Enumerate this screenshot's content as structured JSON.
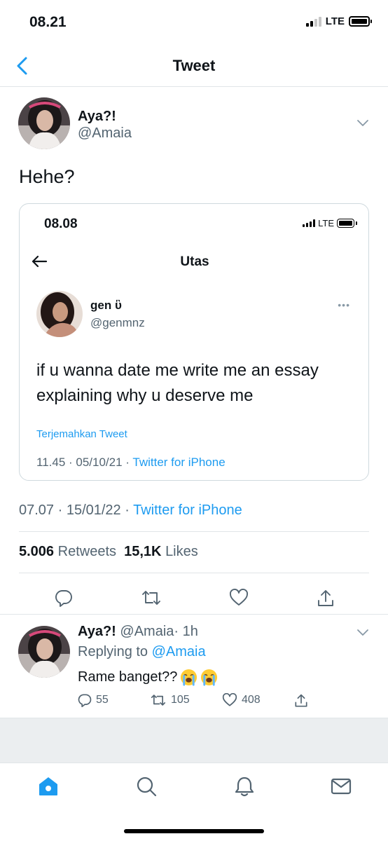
{
  "status_bar": {
    "time": "08.21",
    "network": "LTE"
  },
  "nav": {
    "title": "Tweet",
    "back_icon": "chevron-left-icon"
  },
  "tweet": {
    "author_name": "Aya?!",
    "author_handle": "@Amaia",
    "text": "Hehe?",
    "timestamp": "07.07 · 15/01/22 · ",
    "source": "Twitter for iPhone",
    "retweets_count": "5.006",
    "retweets_label": "Retweets",
    "likes_count": "15,1K",
    "likes_label": "Likes"
  },
  "quoted_screenshot": {
    "status_time": "08.08",
    "network": "LTE",
    "title": "Utas",
    "author_name": "gen ὓ",
    "author_handle": "@genmnz",
    "more": "•••",
    "text": "if u wanna date me write me an essay explaining why u deserve me",
    "translate_label": "Terjemahkan Tweet",
    "timestamp": "11.45 · 05/10/21 · ",
    "source": "Twitter for iPhone"
  },
  "reply": {
    "author_name": "Aya?!",
    "author_handle": "@Amaia",
    "time": "· 1h",
    "replying_prefix": "Replying to ",
    "replying_to": "@Amaia",
    "text": "Rame banget??",
    "replies_count": "55",
    "retweets_count": "105",
    "likes_count": "408"
  },
  "tab_bar": {
    "items": [
      "home-icon",
      "search-icon",
      "notifications-bell-icon",
      "messages-mail-icon"
    ],
    "active": "home-icon"
  },
  "colors": {
    "accent": "#1d9bf0",
    "text": "#0f1419",
    "muted": "#536471",
    "border": "#e1e5e8"
  }
}
